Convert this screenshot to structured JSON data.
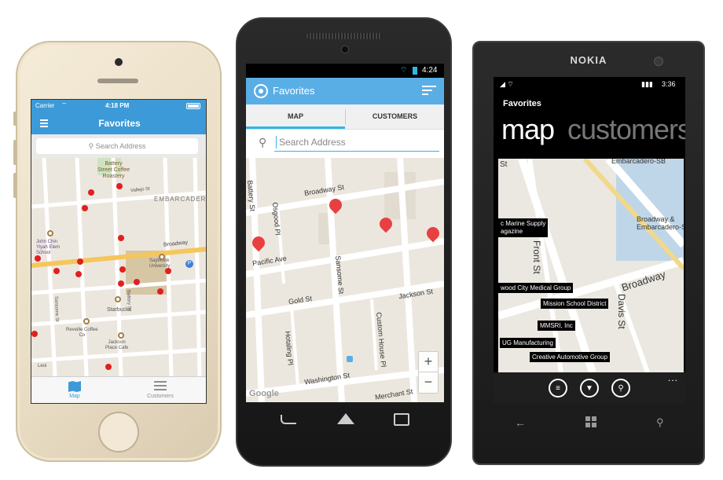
{
  "ios": {
    "status": {
      "carrier": "Carrier",
      "time": "4:18 PM"
    },
    "title": "Favorites",
    "search_placeholder": "Search Address",
    "map_labels": {
      "battery_coffee": "Battery\nStreet Coffee\nRoastery",
      "vallejo": "Vallejo St",
      "embarcadero": "EMBARCADER",
      "john_chin": "John Chin\nYiyah Elem\nSchool",
      "broadway": "Broadway",
      "saybrook": "Saybrook\nUniversity",
      "sansome": "Sansome St",
      "battery": "Battery St",
      "starbucks": "Starbucks",
      "reveille": "Reveille Coffee\nCo",
      "jackson": "Jackson\nPlace Cafe",
      "leoi": "Leoi"
    },
    "tabs": [
      {
        "label": "Map"
      },
      {
        "label": "Customers"
      }
    ],
    "accent": "#3d9ad8"
  },
  "android": {
    "status": {
      "time": "4:24"
    },
    "title": "Favorites",
    "tabs": [
      {
        "label": "MAP"
      },
      {
        "label": "CUSTOMERS"
      }
    ],
    "search_placeholder": "Search Address",
    "map_labels": {
      "broadway": "Broadway St",
      "pacific": "Pacific Ave",
      "gold": "Gold St",
      "jackson": "Jackson St",
      "osgood": "Osgood Pl",
      "sansome": "Sansome St",
      "custom_house": "Custom House Pl",
      "hotaling": "Hotaling Pl",
      "washington": "Washington St",
      "merchant": "Merchant St",
      "battery": "Battery St",
      "google": "Google"
    },
    "zoom": {
      "in": "+",
      "out": "−"
    },
    "accent": "#5aaee6"
  },
  "nokia": {
    "brand": "NOKIA",
    "status": {
      "time": "3:36"
    },
    "app_title": "Favorites",
    "pivot": [
      {
        "label": "map"
      },
      {
        "label": "customers"
      }
    ],
    "map_labels": {
      "st": "St",
      "embarcadero_sb": "Embarcadero-SB",
      "broadway_embarcadero": "Broadway &\nEmbarcadero-SB",
      "front": "Front St",
      "broadway": "Broadway",
      "davis": "Davis St"
    },
    "pins": [
      {
        "label": "c Marine Supply\nagazine"
      },
      {
        "label": "wood City Medical Group"
      },
      {
        "label": "Mission School District"
      },
      {
        "label": "MMSRI, Inc"
      },
      {
        "label": "UG Manufacturing"
      },
      {
        "label": "Creative Automotive Group"
      }
    ],
    "overflow": "..."
  }
}
